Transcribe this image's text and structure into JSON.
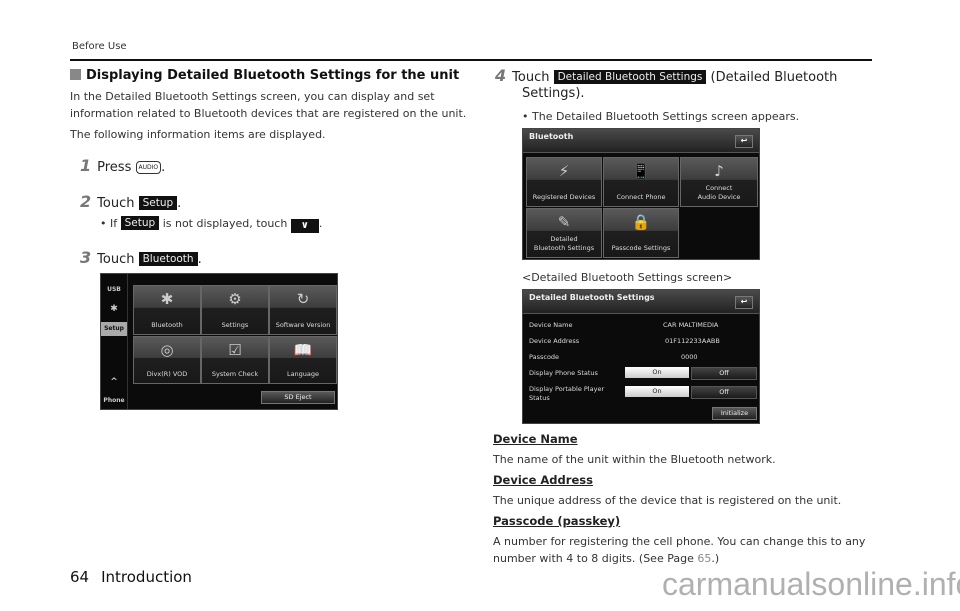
{
  "header": {
    "section_label": "Before Use"
  },
  "section": {
    "title": "Displaying Detailed Bluetooth Settings for the unit",
    "intro_line1": "In the Detailed Bluetooth Settings screen, you can display and set",
    "intro_line2": "information related to Bluetooth devices that are registered on the unit.",
    "intro_line3": "The following information items are displayed."
  },
  "steps": [
    {
      "num": "1",
      "verb": "Press",
      "key": "AUDIO",
      "suffix": "."
    },
    {
      "num": "2",
      "verb": "Touch",
      "chip": "Setup",
      "suffix": ".",
      "bullet_pre": "If",
      "bullet_chip": "Setup",
      "bullet_mid": "is not displayed, touch",
      "bullet_chev": "∨",
      "bullet_suffix": "."
    },
    {
      "num": "3",
      "verb": "Touch",
      "chip": "Bluetooth",
      "suffix": "."
    },
    {
      "num": "4",
      "verb": "Touch",
      "chip": "Detailed Bluetooth Settings",
      "suffix": "(Detailed Bluetooth",
      "line2": "Settings).",
      "bullet": "The Detailed Bluetooth Settings screen appears."
    }
  ],
  "setup_screen": {
    "sidebar": [
      "USB",
      "Bluetooth",
      "Setup",
      "^",
      "Phone"
    ],
    "tiles": [
      {
        "label": "Bluetooth",
        "icon": "✱"
      },
      {
        "label": "Settings",
        "icon": "⚙"
      },
      {
        "label": "Software Version",
        "icon": "↻"
      },
      {
        "label": "Divx(R) VOD",
        "icon": "◎"
      },
      {
        "label": "System Check",
        "icon": "☑"
      },
      {
        "label": "Language",
        "icon": "📖"
      }
    ],
    "sd_eject": "SD Eject"
  },
  "bluetooth_screen": {
    "title": "Bluetooth",
    "back": "↩",
    "tiles": [
      {
        "label": "Registered Devices",
        "icon": "⚡"
      },
      {
        "label": "Connect Phone",
        "icon": "📱"
      },
      {
        "label": "Connect\nAudio Device",
        "line1": "Connect",
        "line2": "Audio Device",
        "icon": "♪"
      },
      {
        "label": "Detailed\nBluetooth Settings",
        "line1": "Detailed",
        "line2": "Bluetooth Settings",
        "icon": "✎"
      },
      {
        "label": "Passcode Settings",
        "icon": "🔒"
      }
    ]
  },
  "detail_caption": "<Detailed Bluetooth Settings screen>",
  "detail_screen": {
    "title": "Detailed Bluetooth Settings",
    "back": "↩",
    "rows": [
      {
        "key": "Device Name",
        "value": "CAR MALTIMEDIA"
      },
      {
        "key": "Device Address",
        "value": "01F112233AABB"
      },
      {
        "key": "Passcode",
        "value": "0000"
      }
    ],
    "toggles": [
      {
        "key": "Display Phone Status",
        "on": "On",
        "off": "Off",
        "selected": "On"
      },
      {
        "key_line1": "Display Portable Player",
        "key_line2": "Status",
        "on": "On",
        "off": "Off",
        "selected": "On"
      }
    ],
    "initialize": "Initialize"
  },
  "definitions": [
    {
      "term": "Device Name",
      "desc": "The name of the unit within the Bluetooth network."
    },
    {
      "term": "Device Address",
      "desc": "The unique address of the device that is registered on the unit."
    },
    {
      "term": "Passcode (passkey)",
      "desc1": "A number for registering the cell phone. You can change this to any",
      "desc2_pre": "number with 4 to 8 digits. (See Page ",
      "page_ref": "65",
      "desc2_post": ".)"
    }
  ],
  "footer": {
    "page_number": "64",
    "chapter": "Introduction"
  },
  "watermark": "carmanualsonline.info"
}
